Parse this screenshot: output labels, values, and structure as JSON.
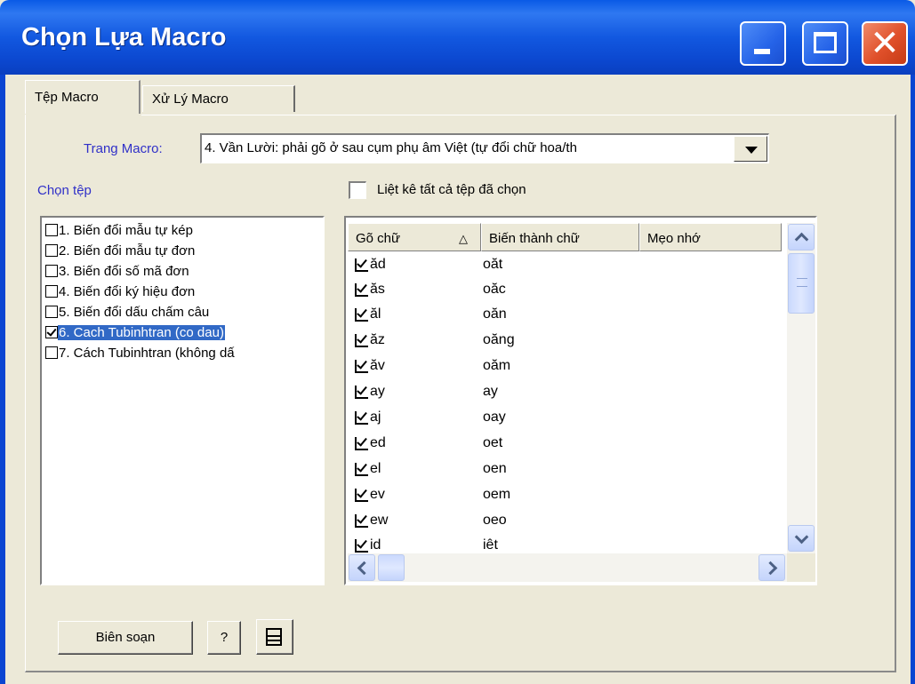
{
  "window": {
    "title": "Chọn Lựa Macro"
  },
  "tabs": [
    "Tệp Macro",
    "Xử Lý Macro"
  ],
  "trang": {
    "label": "Trang Macro:",
    "value": "4. Vần Lười: phải gõ ở sau cụm phụ âm Việt (tự đổi chữ hoa/th"
  },
  "chon_tep": {
    "label": "Chọn tệp"
  },
  "list_all": {
    "label": "Liệt kê tất cả tệp đã chọn",
    "checked": false
  },
  "files": [
    {
      "label": "1. Biến đổi mẫu tự kép",
      "checked": false,
      "selected": false
    },
    {
      "label": "2. Biến đổi mẫu tự đơn",
      "checked": false,
      "selected": false
    },
    {
      "label": "3. Biến đổi số mã đơn",
      "checked": false,
      "selected": false
    },
    {
      "label": "4. Biến đổi ký hiệu đơn",
      "checked": false,
      "selected": false
    },
    {
      "label": "5. Biến đổi dấu chấm câu",
      "checked": false,
      "selected": false
    },
    {
      "label": "6. Cach Tubinhtran (co dau)",
      "checked": true,
      "selected": true
    },
    {
      "label": "7. Cách Tubinhtran (không dấ",
      "checked": false,
      "selected": false
    }
  ],
  "grid": {
    "columns": [
      "Gõ chữ",
      "Biến thành chữ",
      "Mẹo nhớ"
    ],
    "sort_glyph": "△",
    "rows": [
      {
        "go": "ăd",
        "bien": "oăt",
        "checked": true
      },
      {
        "go": "ăs",
        "bien": "oăc",
        "checked": true
      },
      {
        "go": "ăl",
        "bien": "oăn",
        "checked": true
      },
      {
        "go": "ăz",
        "bien": "oăng",
        "checked": true
      },
      {
        "go": "ăv",
        "bien": "oăm",
        "checked": true
      },
      {
        "go": "ay",
        "bien": "ay",
        "checked": true
      },
      {
        "go": "aj",
        "bien": "oay",
        "checked": true
      },
      {
        "go": "ed",
        "bien": "oet",
        "checked": true
      },
      {
        "go": "el",
        "bien": "oen",
        "checked": true
      },
      {
        "go": "ev",
        "bien": "oem",
        "checked": true
      },
      {
        "go": "ew",
        "bien": "oeo",
        "checked": true
      },
      {
        "go": "id",
        "bien": "iêt",
        "checked": true
      }
    ]
  },
  "buttons": {
    "edit": "Biên soạn",
    "help": "?"
  },
  "icons": [
    "minimize-icon",
    "maximize-icon",
    "close-icon",
    "dropdown-arrow-icon",
    "sort-ascending-icon",
    "scroll-up-icon",
    "scroll-down-icon",
    "scroll-left-icon",
    "scroll-right-icon",
    "layout-icon"
  ],
  "colors": {
    "titlebar": "#0a5ae6",
    "selection": "#3169c6",
    "label_blue": "#3030c8",
    "dialog_bg": "#ece9d8"
  }
}
